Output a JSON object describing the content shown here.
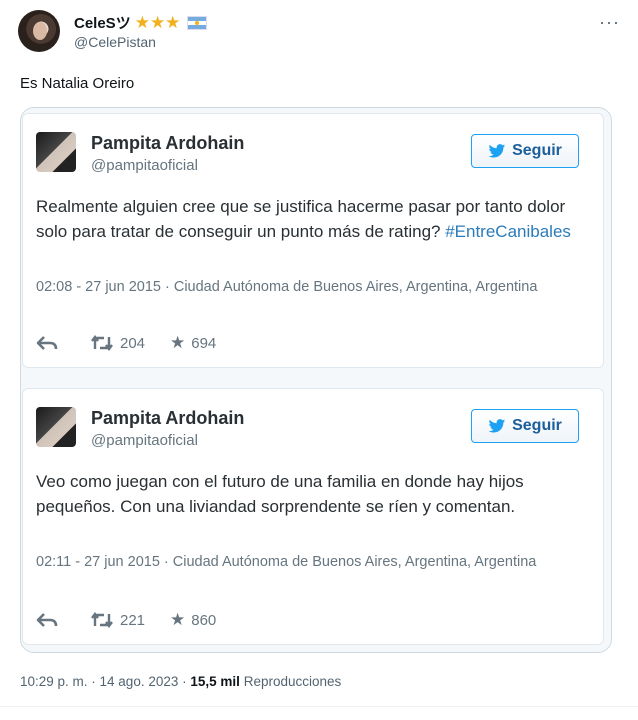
{
  "tweet": {
    "display_name": "CeleSツ",
    "badges": "★★★",
    "handle": "@CelePistan",
    "text": "Es Natalia Oreiro",
    "timestamp": "10:29 p. m. · 14 ago. 2023",
    "views_count": "15,5 mil",
    "views_label": "Reproducciones",
    "separator": "·"
  },
  "embeds": [
    {
      "name": "Pampita Ardohain",
      "handle": "@pampitaoficial",
      "follow_label": "Seguir",
      "text_before": "Realmente alguien cree que se justifica hacerme pasar por tanto dolor solo para tratar de conseguir un punto más de rating? ",
      "hashtag": "#EntreCanibales",
      "meta": "02:08 - 27 jun 2015 · Ciudad Autónoma de Buenos Aires, Argentina, Argentina",
      "retweets": "204",
      "likes": "694"
    },
    {
      "name": "Pampita Ardohain",
      "handle": "@pampitaoficial",
      "follow_label": "Seguir",
      "text_before": "Veo como juegan con el futuro de una familia en donde hay hijos pequeños. Con una liviandad sorprendente se ríen y comentan.",
      "hashtag": "",
      "meta": "02:11 - 27 jun 2015 · Ciudad Autónoma de Buenos Aires, Argentina, Argentina",
      "retweets": "221",
      "likes": "860"
    }
  ],
  "colors": {
    "link": "#2b7bb9",
    "follow_border": "#1da1f2",
    "star": "#f2b01e"
  }
}
